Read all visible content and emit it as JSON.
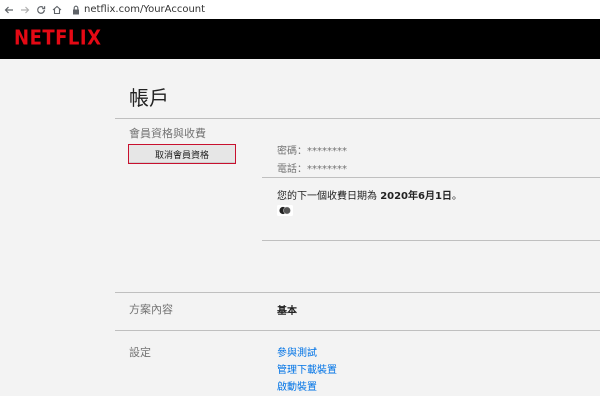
{
  "browser": {
    "url": "netflix.com/YourAccount"
  },
  "header": {
    "logo": "NETFLIX"
  },
  "page": {
    "title": "帳戶"
  },
  "membership": {
    "section_label": "會員資格與收費",
    "cancel_button": "取消會員資格",
    "password_line": "密碼：********",
    "phone_line": "電話：********",
    "billing_prefix": "您的下一個收費日期為 ",
    "billing_date": "2020年6月1日",
    "billing_suffix": "。"
  },
  "plan": {
    "section_label": "方案內容",
    "value": "基本"
  },
  "settings": {
    "section_label": "設定",
    "links": [
      "參與測試",
      "管理下載裝置",
      "啟動裝置"
    ]
  },
  "colors": {
    "brand": "#e50914",
    "link": "#0073e6",
    "header_bg": "#000000"
  }
}
